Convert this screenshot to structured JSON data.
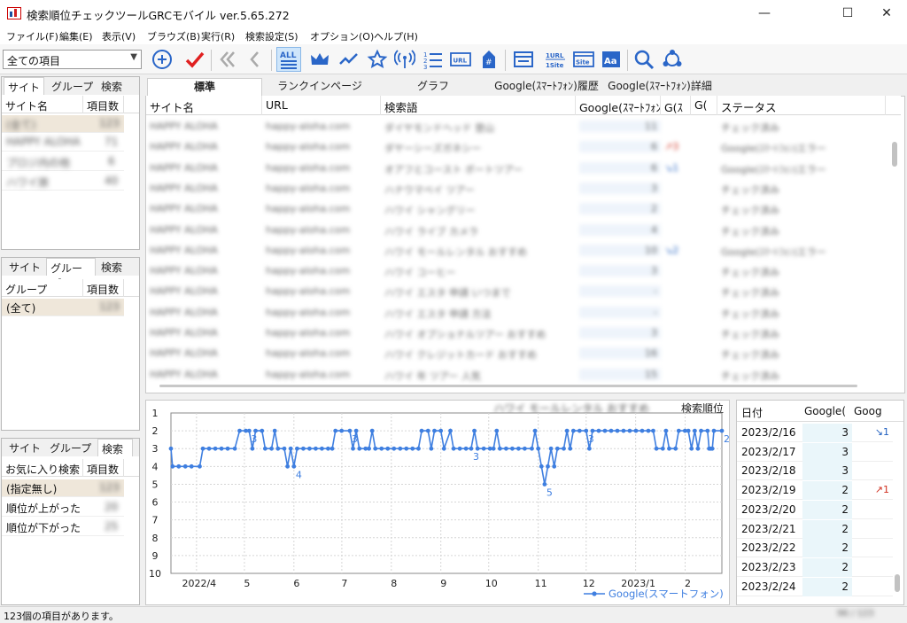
{
  "window": {
    "title": "検索順位チェックツールGRCモバイル ver.5.65.272",
    "controls": [
      "—",
      "☐",
      "✕"
    ]
  },
  "menu": [
    "ファイル(F)",
    "編集(E)",
    "表示(V)",
    "ブラウズ(B)",
    "実行(R)",
    "検索設定(S)",
    "オプション(O)",
    "ヘルプ(H)"
  ],
  "filter_combo": {
    "value": "全ての項目"
  },
  "toolbar": {
    "all_label": "ALL",
    "url_label": "URL",
    "one_url_label": "1URL",
    "one_site_label": "1Site",
    "site_label": "Site",
    "aa_label": "Aa",
    "hash_label": "#"
  },
  "left_panel_sites": {
    "tabs": [
      "サイト",
      "グループ",
      "検索"
    ],
    "headers": [
      "サイト名",
      "項目数"
    ],
    "rows": [
      {
        "name": "(全て)",
        "count": "123"
      },
      {
        "name": "HAPPY ALOHA",
        "count": "71"
      },
      {
        "name": "プロジ内の他",
        "count": "6"
      },
      {
        "name": "ハワイ旅",
        "count": "40"
      }
    ]
  },
  "left_panel_groups": {
    "tabs": [
      "サイト",
      "グループ",
      "検索"
    ],
    "headers": [
      "グループ",
      "項目数"
    ],
    "rows": [
      {
        "name": "(全て)",
        "count": "123"
      }
    ]
  },
  "left_panel_search": {
    "tabs": [
      "サイト",
      "グループ",
      "検索"
    ],
    "headers": [
      "お気に入り検索",
      "項目数"
    ],
    "rows": [
      {
        "name": "(指定無し)",
        "count": "123"
      },
      {
        "name": "順位が上がった",
        "count": "20"
      },
      {
        "name": "順位が下がった",
        "count": "25"
      }
    ]
  },
  "main_tabs": [
    "標準",
    "ランクインページ",
    "グラフ",
    "Google(ｽﾏｰﾄﾌｫﾝ)履歴",
    "Google(ｽﾏｰﾄﾌｫﾝ)詳細"
  ],
  "grid": {
    "headers": [
      "サイト名",
      "URL",
      "検索語",
      "Google(ｽﾏｰﾄﾌｫﾝ",
      "G(ｽ",
      "G(",
      "ステータス"
    ],
    "rows": [
      {
        "site": "HAPPY ALOHA",
        "url": "happy-aloha.com",
        "keyword": "ダイヤモンドヘッド 登山",
        "rank": "11",
        "diff": "",
        "status": "チェック済み"
      },
      {
        "site": "HAPPY ALOHA",
        "url": "happy-aloha.com",
        "keyword": "ダヤーシーズガネシー",
        "rank": "6",
        "diff": "↗3",
        "status": "Google(ｽﾏｰﾄﾌｫﾝ)エラー"
      },
      {
        "site": "HAPPY ALOHA",
        "url": "happy-aloha.com",
        "keyword": "オアフとコースト ボートツアー",
        "rank": "6",
        "diff": "↘1",
        "status": "Google(ｽﾏｰﾄﾌｫﾝ)エラー"
      },
      {
        "site": "HAPPY ALOHA",
        "url": "happy-aloha.com",
        "keyword": "ハナウマベイ ツアー",
        "rank": "3",
        "diff": "",
        "status": "チェック済み"
      },
      {
        "site": "HAPPY ALOHA",
        "url": "happy-aloha.com",
        "keyword": "ハワイ シャングリー",
        "rank": "2",
        "diff": "",
        "status": "チェック済み"
      },
      {
        "site": "HAPPY ALOHA",
        "url": "happy-aloha.com",
        "keyword": "ハワイ ライブ カメラ",
        "rank": "4",
        "diff": "",
        "status": "チェック済み"
      },
      {
        "site": "HAPPY ALOHA",
        "url": "happy-aloha.com",
        "keyword": "ハワイ モールレンタル おすすめ",
        "rank": "10",
        "diff": "↘2",
        "status": "Google(ｽﾏｰﾄﾌｫﾝ)エラー"
      },
      {
        "site": "HAPPY ALOHA",
        "url": "happy-aloha.com",
        "keyword": "ハワイ コーヒー",
        "rank": "3",
        "diff": "",
        "status": "チェック済み"
      },
      {
        "site": "HAPPY ALOHA",
        "url": "happy-aloha.com",
        "keyword": "ハワイ エスタ 申請 いつまで",
        "rank": "-",
        "diff": "",
        "status": "チェック済み"
      },
      {
        "site": "HAPPY ALOHA",
        "url": "happy-aloha.com",
        "keyword": "ハワイ エスタ 申請 方法",
        "rank": "-",
        "diff": "",
        "status": "チェック済み"
      },
      {
        "site": "HAPPY ALOHA",
        "url": "happy-aloha.com",
        "keyword": "ハワイ オプショナルツアー おすすめ",
        "rank": "3",
        "diff": "",
        "status": "チェック済み"
      },
      {
        "site": "HAPPY ALOHA",
        "url": "happy-aloha.com",
        "keyword": "ハワイ クレジットカード おすすめ",
        "rank": "16",
        "diff": "",
        "status": "チェック済み"
      },
      {
        "site": "HAPPY ALOHA",
        "url": "happy-aloha.com",
        "keyword": "ハワイ 年 ツアー 人気",
        "rank": "15",
        "diff": "",
        "status": "チェック済み"
      }
    ]
  },
  "chart_data": {
    "type": "line",
    "title": "検索順位",
    "keyword_caption": "ハワイ モールレンタル おすすめ",
    "y_ticks": [
      "1",
      "2",
      "3",
      "4",
      "5",
      "6",
      "7",
      "8",
      "9",
      "10"
    ],
    "ylim": [
      1,
      10
    ],
    "y_inverted": true,
    "x_ticks": [
      "2022/4",
      "5",
      "6",
      "7",
      "8",
      "9",
      "10",
      "11",
      "12",
      "2023/1",
      "2"
    ],
    "xlim": [
      "2022-03-16",
      "2023-02-24"
    ],
    "series": [
      {
        "name": "Google(スマートフォン)",
        "color": "#3f7fe0",
        "values": [
          [
            "2022-03-16",
            3
          ],
          [
            "2022-03-17",
            4
          ],
          [
            "2022-03-25",
            4
          ],
          [
            "2022-04-03",
            4
          ],
          [
            "2022-04-05",
            3
          ],
          [
            "2022-04-25",
            3
          ],
          [
            "2022-04-28",
            2
          ],
          [
            "2022-05-04",
            2
          ],
          [
            "2022-05-06",
            3
          ],
          [
            "2022-05-08",
            2
          ],
          [
            "2022-05-12",
            2
          ],
          [
            "2022-05-14",
            3
          ],
          [
            "2022-05-18",
            3
          ],
          [
            "2022-05-20",
            2
          ],
          [
            "2022-05-22",
            3
          ],
          [
            "2022-05-26",
            3
          ],
          [
            "2022-05-28",
            4
          ],
          [
            "2022-05-30",
            3
          ],
          [
            "2022-06-01",
            4
          ],
          [
            "2022-06-03",
            3
          ],
          [
            "2022-06-25",
            3
          ],
          [
            "2022-06-27",
            2
          ],
          [
            "2022-07-06",
            2
          ],
          [
            "2022-07-08",
            3
          ],
          [
            "2022-07-10",
            2
          ],
          [
            "2022-07-12",
            3
          ],
          [
            "2022-07-18",
            3
          ],
          [
            "2022-07-20",
            2
          ],
          [
            "2022-07-22",
            3
          ],
          [
            "2022-08-18",
            3
          ],
          [
            "2022-08-20",
            2
          ],
          [
            "2022-08-24",
            2
          ],
          [
            "2022-08-26",
            3
          ],
          [
            "2022-08-28",
            2
          ],
          [
            "2022-09-01",
            2
          ],
          [
            "2022-09-03",
            3
          ],
          [
            "2022-09-07",
            2
          ],
          [
            "2022-09-09",
            3
          ],
          [
            "2022-09-20",
            3
          ],
          [
            "2022-09-22",
            2
          ],
          [
            "2022-09-24",
            3
          ],
          [
            "2022-10-04",
            3
          ],
          [
            "2022-10-06",
            2
          ],
          [
            "2022-10-08",
            3
          ],
          [
            "2022-10-28",
            3
          ],
          [
            "2022-10-30",
            2
          ],
          [
            "2022-11-01",
            3
          ],
          [
            "2022-11-03",
            4
          ],
          [
            "2022-11-05",
            5
          ],
          [
            "2022-11-07",
            4
          ],
          [
            "2022-11-09",
            3
          ],
          [
            "2022-11-11",
            4
          ],
          [
            "2022-11-13",
            3
          ],
          [
            "2022-11-17",
            3
          ],
          [
            "2022-11-19",
            2
          ],
          [
            "2022-11-21",
            3
          ],
          [
            "2022-11-23",
            2
          ],
          [
            "2022-12-01",
            2
          ],
          [
            "2022-12-03",
            3
          ],
          [
            "2022-12-05",
            2
          ],
          [
            "2023-01-12",
            2
          ],
          [
            "2023-01-14",
            3
          ],
          [
            "2023-01-18",
            3
          ],
          [
            "2023-01-20",
            2
          ],
          [
            "2023-01-22",
            3
          ],
          [
            "2023-01-26",
            3
          ],
          [
            "2023-01-28",
            2
          ],
          [
            "2023-02-03",
            2
          ],
          [
            "2023-02-05",
            3
          ],
          [
            "2023-02-07",
            2
          ],
          [
            "2023-02-09",
            3
          ],
          [
            "2023-02-11",
            2
          ],
          [
            "2023-02-15",
            2
          ],
          [
            "2023-02-16",
            3
          ],
          [
            "2023-02-17",
            3
          ],
          [
            "2023-02-18",
            3
          ],
          [
            "2023-02-19",
            2
          ],
          [
            "2023-02-24",
            2
          ]
        ]
      }
    ],
    "point_labels": [
      {
        "date": "2022-05-04",
        "label": "3"
      },
      {
        "date": "2022-06-01",
        "label": "4"
      },
      {
        "date": "2022-07-06",
        "label": "3"
      },
      {
        "date": "2022-09-20",
        "label": "3"
      },
      {
        "date": "2022-11-05",
        "label": "5"
      },
      {
        "date": "2022-12-01",
        "label": "3"
      },
      {
        "date": "2023-02-24",
        "label": "2"
      }
    ],
    "legend": "bottom-right",
    "grid": true
  },
  "history": {
    "headers": [
      "日付",
      "Google(",
      "Goog"
    ],
    "rows": [
      {
        "date": "2023/2/16",
        "rank": "3",
        "change": "↘1",
        "change_color": "#2060c0"
      },
      {
        "date": "2023/2/17",
        "rank": "3",
        "change": "",
        "change_color": ""
      },
      {
        "date": "2023/2/18",
        "rank": "3",
        "change": "",
        "change_color": ""
      },
      {
        "date": "2023/2/19",
        "rank": "2",
        "change": "↗1",
        "change_color": "#d03020"
      },
      {
        "date": "2023/2/20",
        "rank": "2",
        "change": "",
        "change_color": ""
      },
      {
        "date": "2023/2/21",
        "rank": "2",
        "change": "",
        "change_color": ""
      },
      {
        "date": "2023/2/22",
        "rank": "2",
        "change": "",
        "change_color": ""
      },
      {
        "date": "2023/2/23",
        "rank": "2",
        "change": "",
        "change_color": ""
      },
      {
        "date": "2023/2/24",
        "rank": "2",
        "change": "",
        "change_color": ""
      }
    ]
  },
  "status": {
    "text": "123個の項目があります。",
    "counter": "96 / 123"
  }
}
